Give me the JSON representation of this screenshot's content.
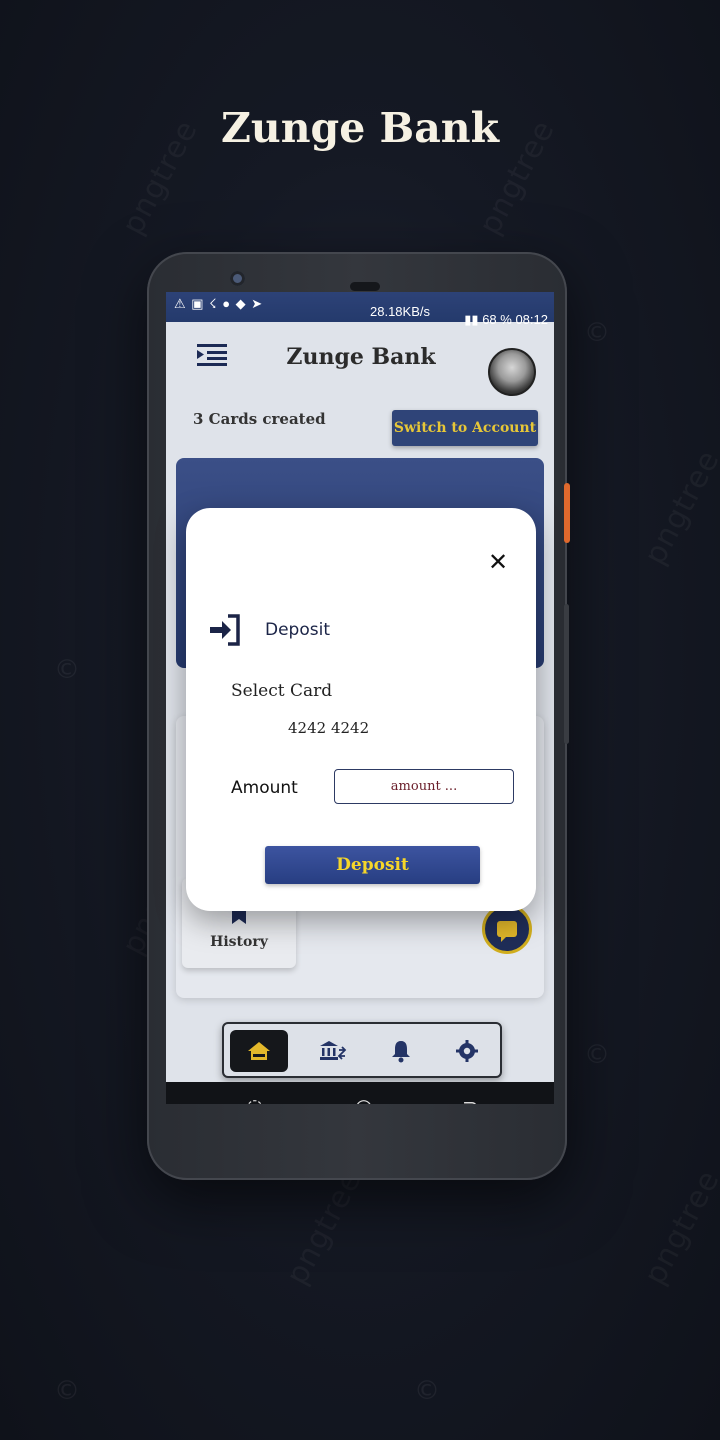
{
  "hero": {
    "title": "Zunge Bank"
  },
  "status_bar": {
    "left_icons": "⚠ ▣ ☇ ● ◆ ➤",
    "speed": "28.18KB/s",
    "battery": "68 %",
    "time": "08:12"
  },
  "app": {
    "title": "Zunge Bank",
    "cards_created": "3 Cards created",
    "switch_button": "Switch to Account",
    "history_label": "History"
  },
  "modal": {
    "title": "Deposit",
    "select_card_label": "Select Card",
    "selected_card": "4242 4242",
    "amount_label": "Amount",
    "amount_placeholder": "amount ...",
    "submit_label": "Deposit"
  },
  "bottom_nav": {
    "items": [
      "home-icon",
      "bank-transfer-icon",
      "bell-icon",
      "settings-icon"
    ],
    "active": "home-icon"
  },
  "colors": {
    "brand_navy": "#2f4478",
    "accent_gold": "#e7c737"
  }
}
